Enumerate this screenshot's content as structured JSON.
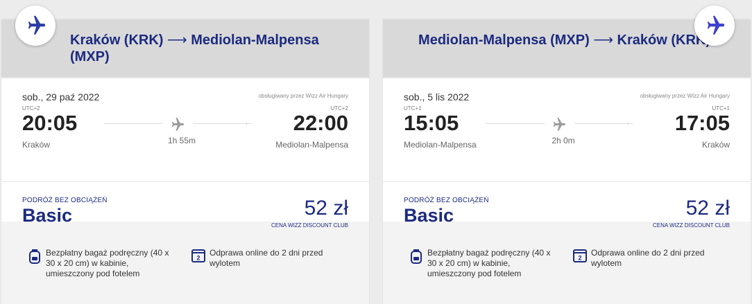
{
  "cards": [
    {
      "route_from": "Kraków (KRK)",
      "route_arrow": "⟶",
      "route_to": "Mediolan-Malpensa (MXP)",
      "date": "sob., 29 paź 2022",
      "operator": "obsługiwany przez Wizz Air Hungary",
      "dep_utc": "UTC+2",
      "arr_utc": "UTC+2",
      "dep_time": "20:05",
      "arr_time": "22:00",
      "dep_city": "Kraków",
      "arr_city": "Mediolan-Malpensa",
      "duration": "1h 55m",
      "fare_category": "PODRÓŻ BEZ OBCIĄŻEŃ",
      "fare_name": "Basic",
      "price": "52 zł",
      "price_note": "CENA WIZZ DISCOUNT CLUB",
      "feature_baggage": "Bezpłatny bagaż podręczny (40 x 30 x 20 cm) w kabinie, umieszczony pod fotelem",
      "feature_checkin": "Odprawa online do 2 dni przed wylotem",
      "checkin_icon_number": "2"
    },
    {
      "route_from": "Mediolan-Malpensa (MXP)",
      "route_arrow": "⟶",
      "route_to": "Kraków (KRK)",
      "date": "sob., 5 lis 2022",
      "operator": "obsługiwany przez Wizz Air Hungary",
      "dep_utc": "UTC+1",
      "arr_utc": "UTC+1",
      "dep_time": "15:05",
      "arr_time": "17:05",
      "dep_city": "Mediolan-Malpensa",
      "arr_city": "Kraków",
      "duration": "2h 0m",
      "fare_category": "PODRÓŻ BEZ OBCIĄŻEŃ",
      "fare_name": "Basic",
      "price": "52 zł",
      "price_note": "CENA WIZZ DISCOUNT CLUB",
      "feature_baggage": "Bezpłatny bagaż podręczny (40 x 30 x 20 cm) w kabinie, umieszczony pod fotelem",
      "feature_checkin": "Odprawa online do 2 dni przed wylotem",
      "checkin_icon_number": "2"
    }
  ],
  "icons": {
    "badge": "airplane-icon",
    "mid": "airplane-icon",
    "baggage": "backpack-icon",
    "checkin": "calendar-icon"
  },
  "colors": {
    "brand_navy": "#1c2a80",
    "badge_plane_outbound": "#2b3ca6",
    "badge_plane_return": "#3a3fd0",
    "header_grey": "#d9d9d9"
  }
}
